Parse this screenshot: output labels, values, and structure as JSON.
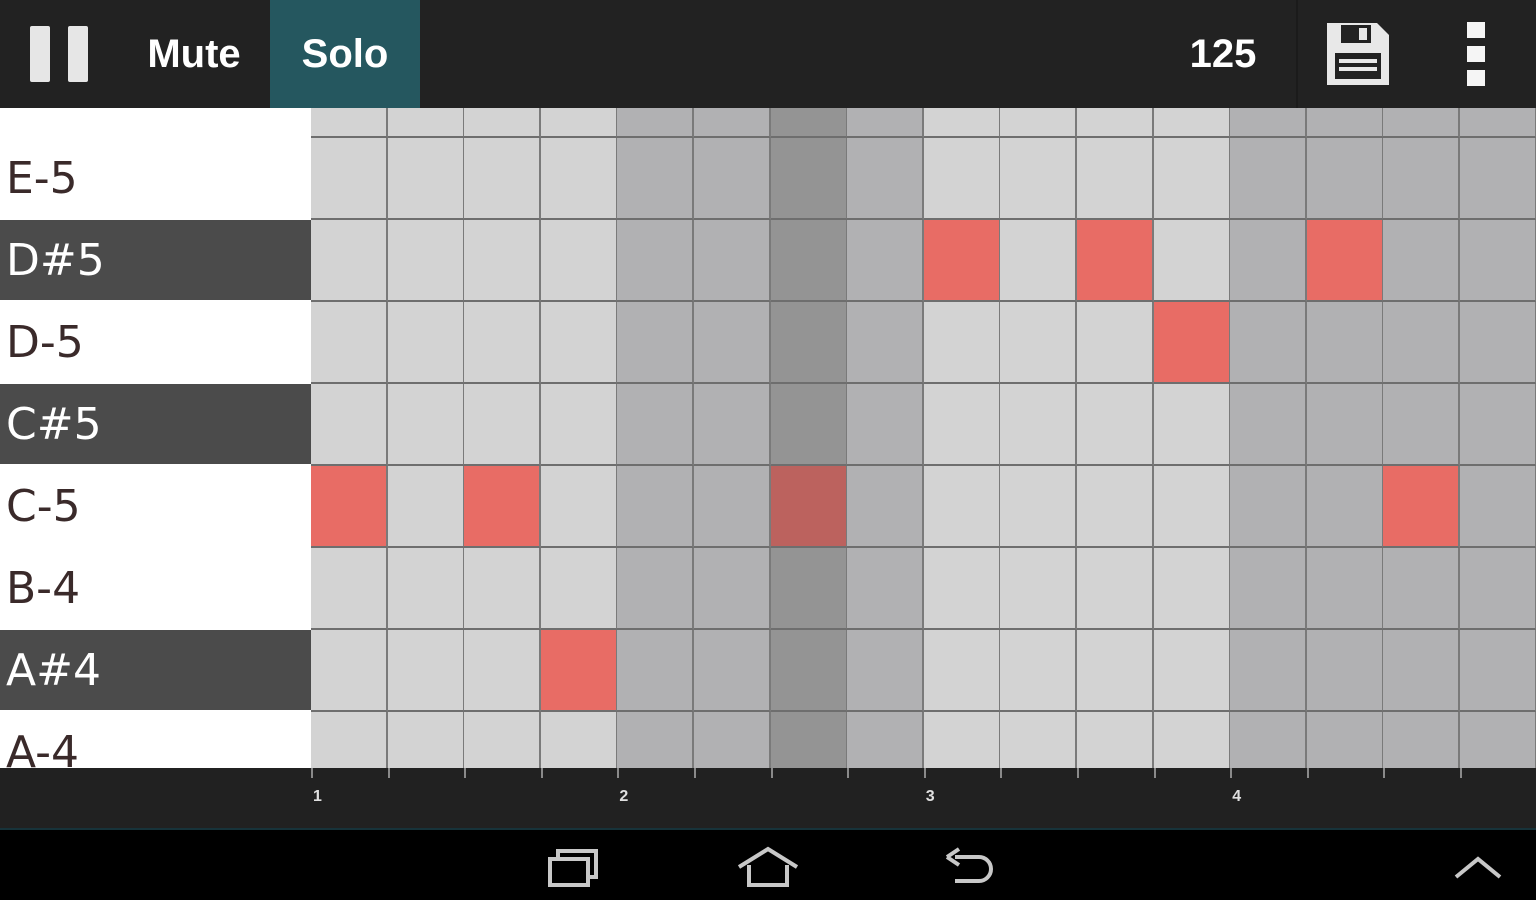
{
  "toolbar": {
    "pause_icon": "pause-icon",
    "mute_label": "Mute",
    "solo_label": "Solo",
    "tempo": "125",
    "save_icon": "floppy-disk-icon",
    "menu_icon": "overflow-menu-icon",
    "colors": {
      "bar_bg": "#222222",
      "solo_active_bg": "#25575f"
    }
  },
  "note_rows": [
    {
      "label": "",
      "sharp": false
    },
    {
      "label": "E-5",
      "sharp": false
    },
    {
      "label": "D#5",
      "sharp": true
    },
    {
      "label": "D-5",
      "sharp": false
    },
    {
      "label": "C#5",
      "sharp": true
    },
    {
      "label": "C-5",
      "sharp": false
    },
    {
      "label": "B-4",
      "sharp": false
    },
    {
      "label": "A#4",
      "sharp": true
    },
    {
      "label": "A-4",
      "sharp": false
    }
  ],
  "grid": {
    "columns": 16,
    "beat_shading": [
      "light",
      "light",
      "light",
      "light",
      "dark",
      "dark",
      "playhead",
      "dark",
      "light",
      "light",
      "light",
      "light",
      "dark",
      "dark",
      "dark",
      "dark"
    ],
    "active_notes": [
      {
        "row": 2,
        "col": 8
      },
      {
        "row": 2,
        "col": 10
      },
      {
        "row": 2,
        "col": 13
      },
      {
        "row": 3,
        "col": 11
      },
      {
        "row": 5,
        "col": 0
      },
      {
        "row": 5,
        "col": 2
      },
      {
        "row": 5,
        "col": 6
      },
      {
        "row": 5,
        "col": 14
      },
      {
        "row": 7,
        "col": 3
      }
    ],
    "colors": {
      "light": "#d3d3d3",
      "dark": "#b1b1b3",
      "playhead": "#949494",
      "note": "#e86c65",
      "note_on_playhead": "#bc625e"
    }
  },
  "timeline": {
    "bar_labels": [
      "1",
      "2",
      "3",
      "4"
    ]
  },
  "navbar": {
    "recents_icon": "recent-apps-icon",
    "home_icon": "home-icon",
    "back_icon": "back-icon",
    "up_icon": "chevron-up-icon"
  }
}
